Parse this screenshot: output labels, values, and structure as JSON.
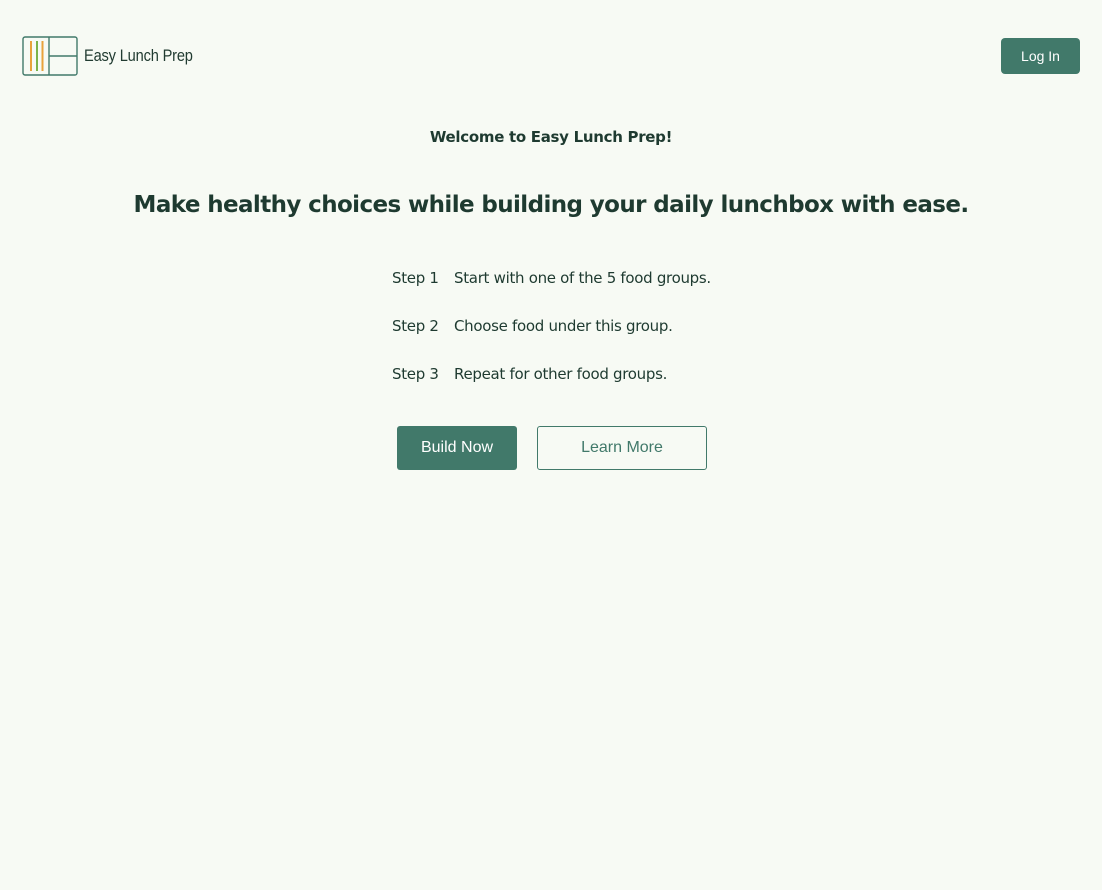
{
  "header": {
    "logo_text": "Easy Lunch Prep",
    "login_label": "Log In"
  },
  "main": {
    "welcome": "Welcome to Easy Lunch Prep!",
    "headline": "Make healthy choices while building your daily lunchbox with ease.",
    "steps": [
      {
        "label": "Step 1",
        "text": "Start with one of the 5 food groups."
      },
      {
        "label": "Step 2",
        "text": "Choose food under this group."
      },
      {
        "label": "Step 3",
        "text": "Repeat for other food groups."
      }
    ],
    "build_label": "Build Now",
    "learn_label": "Learn More"
  },
  "colors": {
    "background": "#f7faf4",
    "accent": "#41796a",
    "text": "#1e3a30",
    "logo_orange": "#e9a23b",
    "logo_green": "#7bb34a"
  },
  "icons": {
    "logo": "lunchbox-logo-icon"
  }
}
